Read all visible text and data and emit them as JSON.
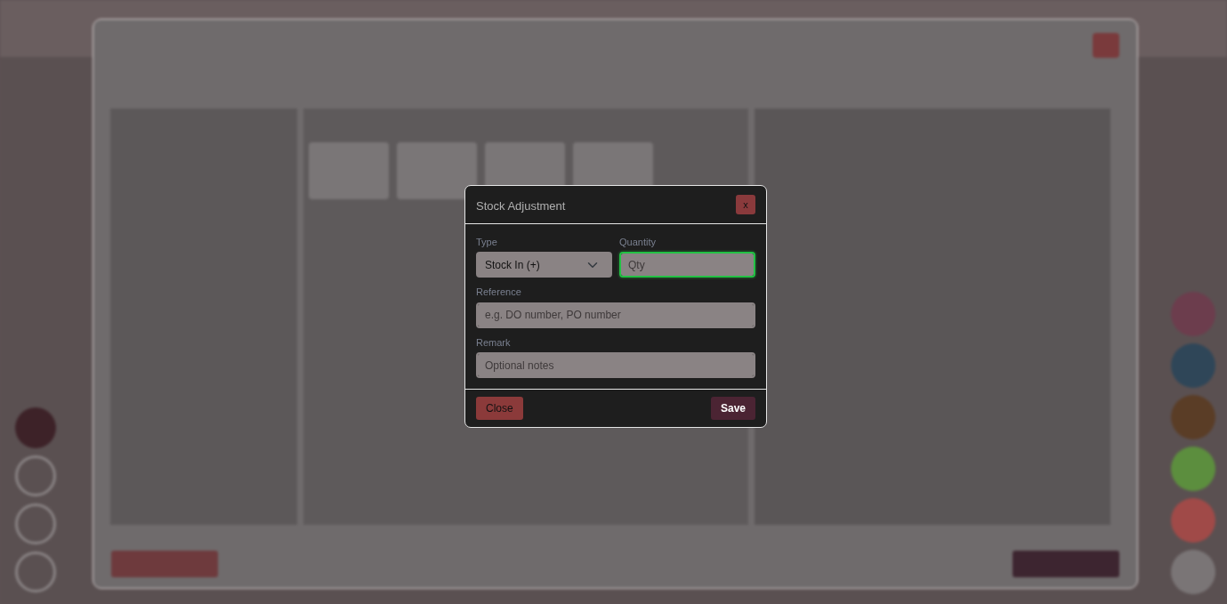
{
  "modal": {
    "title": "Stock Adjustment",
    "close_label": "x",
    "fields": [
      {
        "kind": "select",
        "label": "Type",
        "value": "Stock In (+)",
        "focused": false
      },
      {
        "kind": "input",
        "label": "Quantity",
        "placeholder": "Qty",
        "focused": true
      },
      {
        "kind": "input",
        "label": "Reference",
        "placeholder": "e.g. DO number, PO number",
        "focused": false
      },
      {
        "kind": "input",
        "label": "Remark",
        "placeholder": "Optional notes",
        "focused": false
      }
    ],
    "buttons": [
      {
        "kind": "close",
        "label": "Close"
      },
      {
        "kind": "save",
        "label": "Save"
      }
    ]
  }
}
